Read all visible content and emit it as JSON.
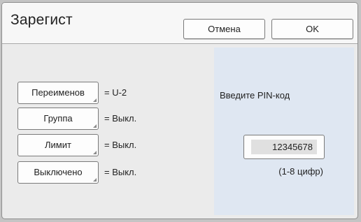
{
  "dialog": {
    "title": "Зарегист",
    "cancel_label": "Отмена",
    "ok_label": "OK"
  },
  "settings": [
    {
      "button_label": "Переименов",
      "value": "= U-2"
    },
    {
      "button_label": "Группа",
      "value": "= Выкл."
    },
    {
      "button_label": "Лимит",
      "value": "= Выкл."
    },
    {
      "button_label": "Выключено",
      "value": "= Выкл."
    }
  ],
  "pin": {
    "label": "Введите PIN-код",
    "value": "12345678",
    "hint": "(1-8 цифр)"
  }
}
